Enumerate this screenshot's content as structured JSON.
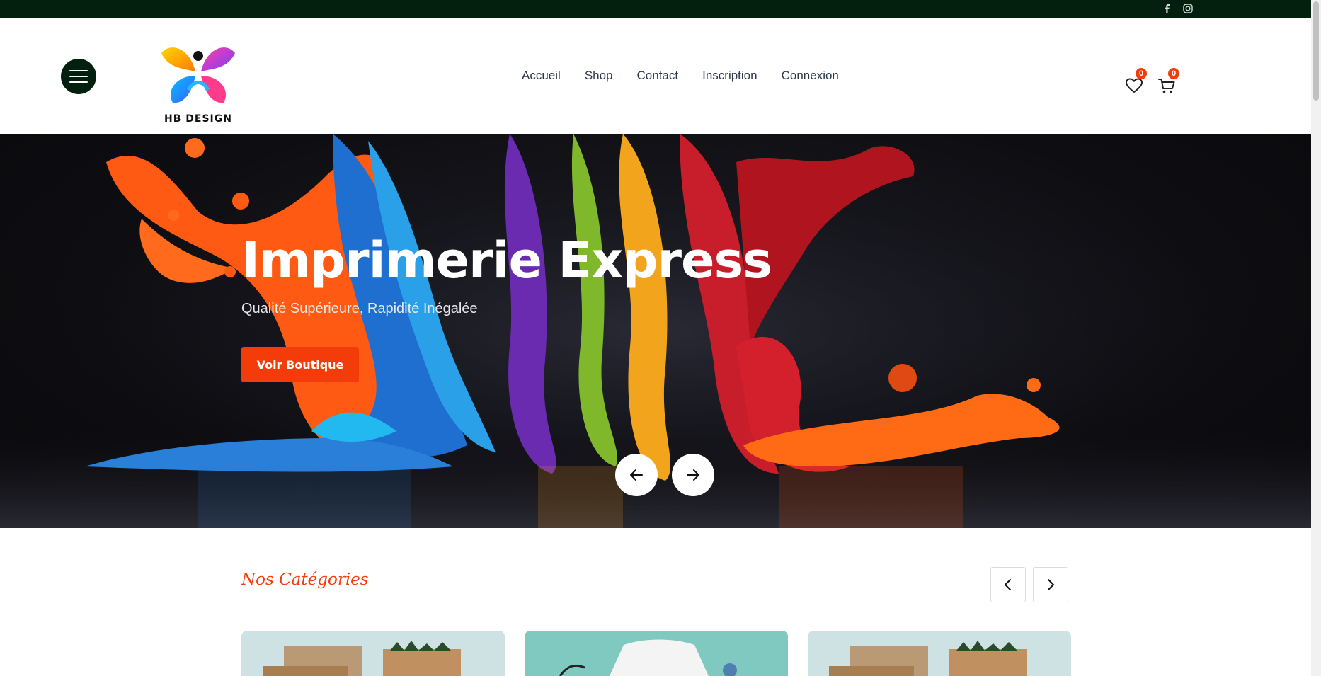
{
  "topbar": {
    "social": [
      {
        "icon": "facebook-icon"
      },
      {
        "icon": "instagram-icon"
      }
    ]
  },
  "header": {
    "logo_text": "HB DESIGN",
    "nav": [
      "Accueil",
      "Shop",
      "Contact",
      "Inscription",
      "Connexion"
    ],
    "wishlist_count": "0",
    "cart_count": "0"
  },
  "hero": {
    "title": "Imprimerie Express",
    "subtitle": "Qualité Supérieure, Rapidité Inégalée",
    "button_label": "Voir Boutique"
  },
  "categories": {
    "title": "Nos Catégories"
  },
  "colors": {
    "accent": "#f43b0a",
    "dark_green": "#03200f"
  }
}
